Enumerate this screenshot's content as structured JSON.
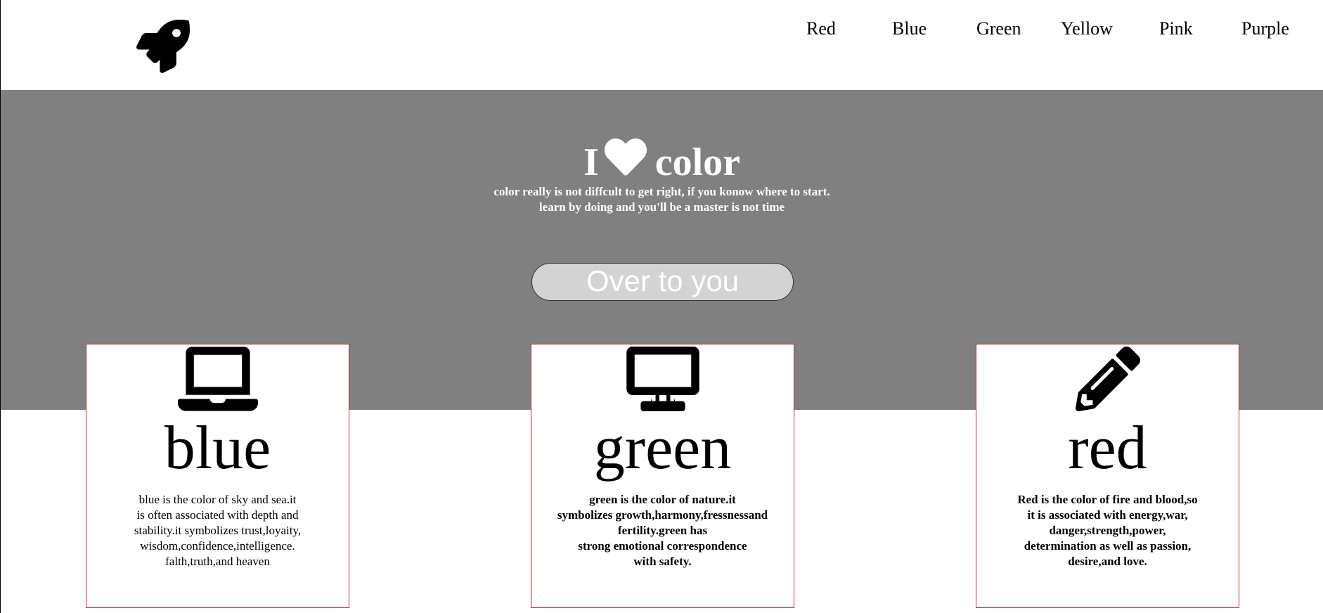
{
  "header": {
    "logo_icon": "rocket-icon",
    "nav": [
      {
        "label": "Red"
      },
      {
        "label": "Blue"
      },
      {
        "label": "Green"
      },
      {
        "label": "Yellow"
      },
      {
        "label": "Pink"
      },
      {
        "label": "Purple"
      }
    ]
  },
  "hero": {
    "title_prefix": "I",
    "title_icon": "heart-icon",
    "title_suffix": "color",
    "subtitle_line1": "color really is not diffcult to get right, if you konow where to start.",
    "subtitle_line2": "learn by doing and you'll be a master is not time",
    "cta_label": "Over to you",
    "background": "#808080"
  },
  "cards": [
    {
      "icon": "laptop-icon",
      "title": "blue",
      "text": "blue is the color of sky and sea.it\nis often associated with depth and\nstability.it symbolizes trust,loyaity,\nwisdom,confidence,intelligence.\nfalth,truth,and heaven"
    },
    {
      "icon": "desktop-icon",
      "title": "green",
      "text": "green is the color of nature.it\nsymbolizes growth,harmony,fressnessand\nfertility.green has\nstrong emotional correspondence\nwith safety."
    },
    {
      "icon": "pencil-icon",
      "title": "red",
      "text": "Red is the color of fire and blood,so\nit is associated with energy,war,\ndanger,strength,power,\ndetermination as well as passion,\ndesire,and love."
    }
  ],
  "colors": {
    "card_border": "#c0272d",
    "cta_background": "#d3d3d3"
  }
}
